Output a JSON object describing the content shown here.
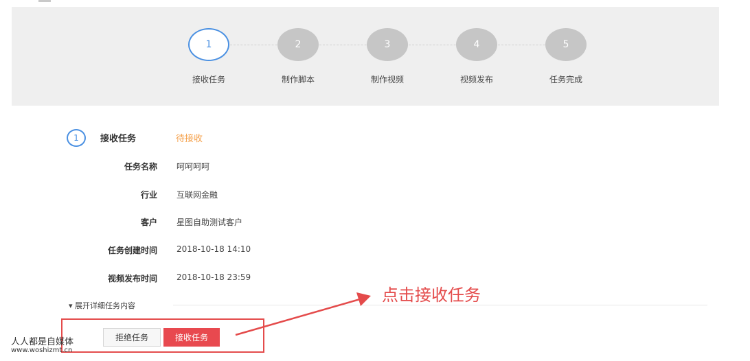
{
  "steps": [
    {
      "number": "1",
      "label": "接收任务",
      "active": true
    },
    {
      "number": "2",
      "label": "制作脚本",
      "active": false
    },
    {
      "number": "3",
      "label": "制作视频",
      "active": false
    },
    {
      "number": "4",
      "label": "视频发布",
      "active": false
    },
    {
      "number": "5",
      "label": "任务完成",
      "active": false
    }
  ],
  "section": {
    "number": "1",
    "title": "接收任务",
    "status": "待接收"
  },
  "details": [
    {
      "label": "任务名称",
      "value": "呵呵呵呵"
    },
    {
      "label": "行业",
      "value": "互联网金融"
    },
    {
      "label": "客户",
      "value": "星图自助测试客户"
    },
    {
      "label": "任务创建时间",
      "value": "2018-10-18 14:10"
    },
    {
      "label": "视频发布时间",
      "value": "2018-10-18 23:59"
    }
  ],
  "expand_label": "▾ 展开详细任务内容",
  "buttons": {
    "reject": "拒绝任务",
    "accept": "接收任务"
  },
  "annotation": {
    "text": "点击接收任务",
    "color": "#e44b4b"
  },
  "watermark": {
    "line1": "人人都是自媒体",
    "line2": "www.woshizmt.cn"
  },
  "colors": {
    "accent": "#4a90e2",
    "status": "#f5a04a",
    "primary_button": "#e8494f",
    "step_inactive": "#c6c6c6"
  }
}
